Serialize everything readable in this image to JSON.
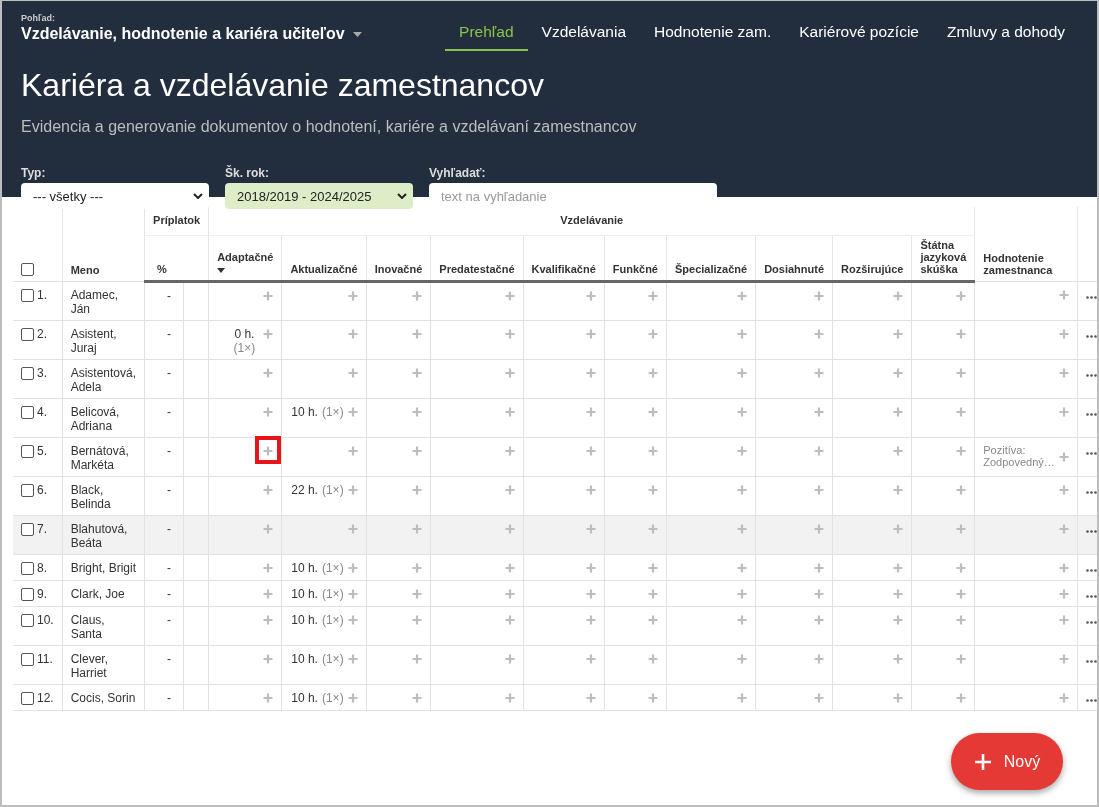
{
  "header": {
    "view_label": "Pohľad:",
    "view_title": "Vzdelávanie, hodnotenie a kariéra učiteľov",
    "nav": [
      {
        "label": "Prehľad",
        "selected": true
      },
      {
        "label": "Vzdelávania",
        "selected": false
      },
      {
        "label": "Hodnotenie zam.",
        "selected": false
      },
      {
        "label": "Kariérové pozície",
        "selected": false
      },
      {
        "label": "Zmluvy a dohody",
        "selected": false
      }
    ],
    "title": "Kariéra a vzdelávanie zamestnancov",
    "subtitle": "Evidencia a generovanie dokumentov o hodnotení, kariére a vzdelávaní zamestnancov"
  },
  "filters": [
    {
      "label": "Typ:",
      "kind": "select",
      "value": "--- všetky ---",
      "active": false
    },
    {
      "label": "Šk. rok:",
      "kind": "select",
      "value": "2018/2019 - 2024/2025",
      "active": true
    },
    {
      "label": "Vyhľadať:",
      "kind": "search",
      "placeholder": "text na vyhľadanie"
    }
  ],
  "table": {
    "select_all_checked": false,
    "name_header": "Meno",
    "surcharge_group": "Príplatok",
    "surcharge_header": "%",
    "education_group": "Vzdelávanie",
    "education_columns": [
      {
        "label": "Adaptačné",
        "sorted": true
      },
      {
        "label": "Aktualizačné",
        "sorted": false
      },
      {
        "label": "Inovačné",
        "sorted": false
      },
      {
        "label": "Predatestačné",
        "sorted": false
      },
      {
        "label": "Kvalifikačné",
        "sorted": false
      },
      {
        "label": "Funkčné",
        "sorted": false
      },
      {
        "label": "Špecializačné",
        "sorted": false
      },
      {
        "label": "Dosiahnuté",
        "sorted": false
      },
      {
        "label": "Rozširujúce",
        "sorted": false
      },
      {
        "label": "Štátna jazyková skúška",
        "sorted": false
      }
    ],
    "evaluation_header": "Hodnotenie zamestnanca",
    "rows": [
      {
        "number": "1.",
        "name": "Adamec, Ján",
        "wrapped": true,
        "checked": false,
        "hovered": false,
        "surcharge": "-",
        "education": [
          {
            "kind": "add"
          },
          {
            "kind": "add"
          },
          {
            "kind": "add"
          },
          {
            "kind": "add"
          },
          {
            "kind": "add"
          },
          {
            "kind": "add"
          },
          {
            "kind": "add"
          },
          {
            "kind": "add"
          },
          {
            "kind": "add"
          },
          {
            "kind": "add"
          }
        ],
        "evaluation": {
          "kind": "add"
        }
      },
      {
        "number": "2.",
        "name": "Asistent, Juraj",
        "wrapped": true,
        "checked": false,
        "hovered": false,
        "surcharge": "-",
        "education": [
          {
            "kind": "hours",
            "hours": "0 h.",
            "count": "(1×)"
          },
          {
            "kind": "add"
          },
          {
            "kind": "add"
          },
          {
            "kind": "add"
          },
          {
            "kind": "add"
          },
          {
            "kind": "add"
          },
          {
            "kind": "add"
          },
          {
            "kind": "add"
          },
          {
            "kind": "add"
          },
          {
            "kind": "add"
          }
        ],
        "evaluation": {
          "kind": "add"
        }
      },
      {
        "number": "3.",
        "name": "Asistentová, Adela",
        "wrapped": true,
        "checked": false,
        "hovered": false,
        "surcharge": "-",
        "education": [
          {
            "kind": "add"
          },
          {
            "kind": "add"
          },
          {
            "kind": "add"
          },
          {
            "kind": "add"
          },
          {
            "kind": "add"
          },
          {
            "kind": "add"
          },
          {
            "kind": "add"
          },
          {
            "kind": "add"
          },
          {
            "kind": "add"
          },
          {
            "kind": "add"
          }
        ],
        "evaluation": {
          "kind": "add"
        }
      },
      {
        "number": "4.",
        "name": "Belicová, Adriana",
        "wrapped": true,
        "checked": false,
        "hovered": false,
        "surcharge": "-",
        "education": [
          {
            "kind": "add"
          },
          {
            "kind": "hours",
            "hours": "10 h.",
            "count": "(1×)"
          },
          {
            "kind": "add"
          },
          {
            "kind": "add"
          },
          {
            "kind": "add"
          },
          {
            "kind": "add"
          },
          {
            "kind": "add"
          },
          {
            "kind": "add"
          },
          {
            "kind": "add"
          },
          {
            "kind": "add"
          }
        ],
        "evaluation": {
          "kind": "add"
        }
      },
      {
        "number": "5.",
        "name": "Bernátová, Markéta",
        "wrapped": true,
        "checked": false,
        "hovered": false,
        "surcharge": "-",
        "education": [
          {
            "kind": "add",
            "highlighted": true
          },
          {
            "kind": "add"
          },
          {
            "kind": "add"
          },
          {
            "kind": "add"
          },
          {
            "kind": "add"
          },
          {
            "kind": "add"
          },
          {
            "kind": "add"
          },
          {
            "kind": "add"
          },
          {
            "kind": "add"
          },
          {
            "kind": "add"
          }
        ],
        "evaluation": {
          "kind": "note",
          "note": "Pozitíva: Zodpovedný…"
        }
      },
      {
        "number": "6.",
        "name": "Black, Belinda",
        "wrapped": true,
        "checked": false,
        "hovered": false,
        "surcharge": "-",
        "education": [
          {
            "kind": "add"
          },
          {
            "kind": "hours",
            "hours": "22 h.",
            "count": "(1×)"
          },
          {
            "kind": "add"
          },
          {
            "kind": "add"
          },
          {
            "kind": "add"
          },
          {
            "kind": "add"
          },
          {
            "kind": "add"
          },
          {
            "kind": "add"
          },
          {
            "kind": "add"
          },
          {
            "kind": "add"
          }
        ],
        "evaluation": {
          "kind": "add"
        }
      },
      {
        "number": "7.",
        "name": "Blahutová, Beáta",
        "wrapped": true,
        "checked": false,
        "hovered": true,
        "surcharge": "-",
        "education": [
          {
            "kind": "add"
          },
          {
            "kind": "add"
          },
          {
            "kind": "add"
          },
          {
            "kind": "add"
          },
          {
            "kind": "add"
          },
          {
            "kind": "add"
          },
          {
            "kind": "add"
          },
          {
            "kind": "add"
          },
          {
            "kind": "add"
          },
          {
            "kind": "add"
          }
        ],
        "evaluation": {
          "kind": "add"
        }
      },
      {
        "number": "8.",
        "name": "Bright, Brigit",
        "wrapped": false,
        "checked": false,
        "hovered": false,
        "surcharge": "-",
        "education": [
          {
            "kind": "add"
          },
          {
            "kind": "hours",
            "hours": "10 h.",
            "count": "(1×)"
          },
          {
            "kind": "add"
          },
          {
            "kind": "add"
          },
          {
            "kind": "add"
          },
          {
            "kind": "add"
          },
          {
            "kind": "add"
          },
          {
            "kind": "add"
          },
          {
            "kind": "add"
          },
          {
            "kind": "add"
          }
        ],
        "evaluation": {
          "kind": "add"
        }
      },
      {
        "number": "9.",
        "name": "Clark, Joe",
        "wrapped": false,
        "checked": false,
        "hovered": false,
        "surcharge": "-",
        "education": [
          {
            "kind": "add"
          },
          {
            "kind": "hours",
            "hours": "10 h.",
            "count": "(1×)"
          },
          {
            "kind": "add"
          },
          {
            "kind": "add"
          },
          {
            "kind": "add"
          },
          {
            "kind": "add"
          },
          {
            "kind": "add"
          },
          {
            "kind": "add"
          },
          {
            "kind": "add"
          },
          {
            "kind": "add"
          }
        ],
        "evaluation": {
          "kind": "add"
        }
      },
      {
        "number": "10.",
        "name": "Claus, Santa",
        "wrapped": true,
        "checked": false,
        "hovered": false,
        "surcharge": "-",
        "education": [
          {
            "kind": "add"
          },
          {
            "kind": "hours",
            "hours": "10 h.",
            "count": "(1×)"
          },
          {
            "kind": "add"
          },
          {
            "kind": "add"
          },
          {
            "kind": "add"
          },
          {
            "kind": "add"
          },
          {
            "kind": "add"
          },
          {
            "kind": "add"
          },
          {
            "kind": "add"
          },
          {
            "kind": "add"
          }
        ],
        "evaluation": {
          "kind": "add"
        }
      },
      {
        "number": "11.",
        "name": "Clever, Harriet",
        "wrapped": true,
        "checked": false,
        "hovered": false,
        "surcharge": "-",
        "education": [
          {
            "kind": "add"
          },
          {
            "kind": "hours",
            "hours": "10 h.",
            "count": "(1×)"
          },
          {
            "kind": "add"
          },
          {
            "kind": "add"
          },
          {
            "kind": "add"
          },
          {
            "kind": "add"
          },
          {
            "kind": "add"
          },
          {
            "kind": "add"
          },
          {
            "kind": "add"
          },
          {
            "kind": "add"
          }
        ],
        "evaluation": {
          "kind": "add"
        }
      },
      {
        "number": "12.",
        "name": "Cocis, Sorin",
        "wrapped": false,
        "checked": false,
        "hovered": false,
        "surcharge": "-",
        "education": [
          {
            "kind": "add"
          },
          {
            "kind": "hours",
            "hours": "10 h.",
            "count": "(1×)"
          },
          {
            "kind": "add"
          },
          {
            "kind": "add"
          },
          {
            "kind": "add"
          },
          {
            "kind": "add"
          },
          {
            "kind": "add"
          },
          {
            "kind": "add"
          },
          {
            "kind": "add"
          },
          {
            "kind": "add"
          }
        ],
        "evaluation": {
          "kind": "add"
        }
      }
    ]
  },
  "fab": {
    "label": "Nový"
  }
}
